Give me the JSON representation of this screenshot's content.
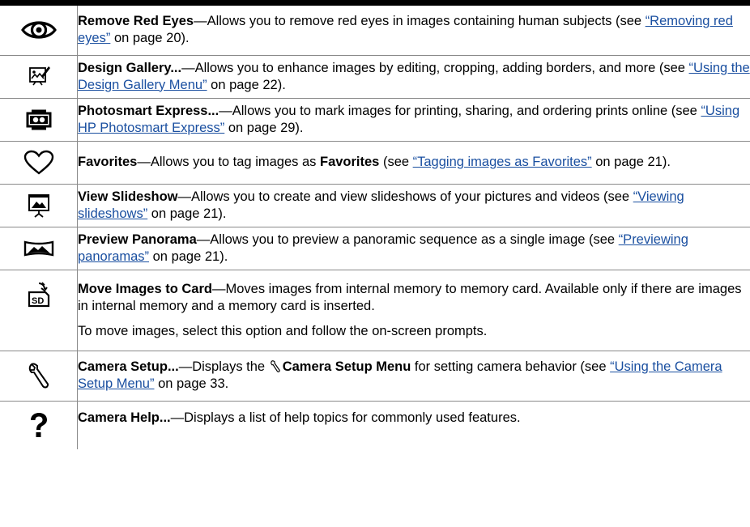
{
  "rows": [
    {
      "icon": "eye-icon",
      "title": "Remove Red Eyes",
      "text1": "—Allows you to remove red eyes in images containing human subjects (see ",
      "link": "“Removing red eyes”",
      "text2": " on page 20)."
    },
    {
      "icon": "design-gallery-icon",
      "title": "Design Gallery...",
      "text1": "—Allows you to enhance images by editing, cropping, adding borders, and more (see ",
      "link": "“Using the Design Gallery Menu”",
      "text2": " on page 22)."
    },
    {
      "icon": "photosmart-express-icon",
      "title": "Photosmart Express...",
      "text1": "—Allows you to mark images for printing, sharing, and ordering prints online (see ",
      "link": "“Using HP Photosmart Express”",
      "text2": " on page 29)."
    },
    {
      "icon": "heart-icon",
      "title": "Favorites",
      "text1": "—Allows you to tag images as ",
      "bold2": "Favorites",
      "text2": " (see ",
      "link": "“Tagging images as Favorites”",
      "text3": " on page 21)."
    },
    {
      "icon": "slideshow-icon",
      "title": "View Slideshow",
      "text1": "—Allows you to create and view slideshows of your pictures and videos (see ",
      "link": "“Viewing slideshows”",
      "text2": " on page 21)."
    },
    {
      "icon": "panorama-icon",
      "title": "Preview Panorama",
      "text1": "—Allows you to preview a panoramic sequence as a single image (see ",
      "link": "“Previewing panoramas”",
      "text2": " on page 21)."
    },
    {
      "icon": "move-to-sd-card-icon",
      "title": "Move Images to Card",
      "text1": "—Moves images from internal memory to memory card. Available only if there are images in internal memory and a memory card is inserted.",
      "para2": "To move images, select this option and follow the on-screen prompts."
    },
    {
      "icon": "wrench-icon",
      "title": "Camera Setup...",
      "text1": "—Displays the ",
      "bold2": "Camera Setup Menu",
      "text2": " for setting camera behavior (see ",
      "link": "“Using the Camera Setup Menu”",
      "text3": " on page 33."
    },
    {
      "icon": "help-question-icon",
      "title": "Camera Help...",
      "text1": "—Displays a list of help topics for commonly used features."
    }
  ]
}
